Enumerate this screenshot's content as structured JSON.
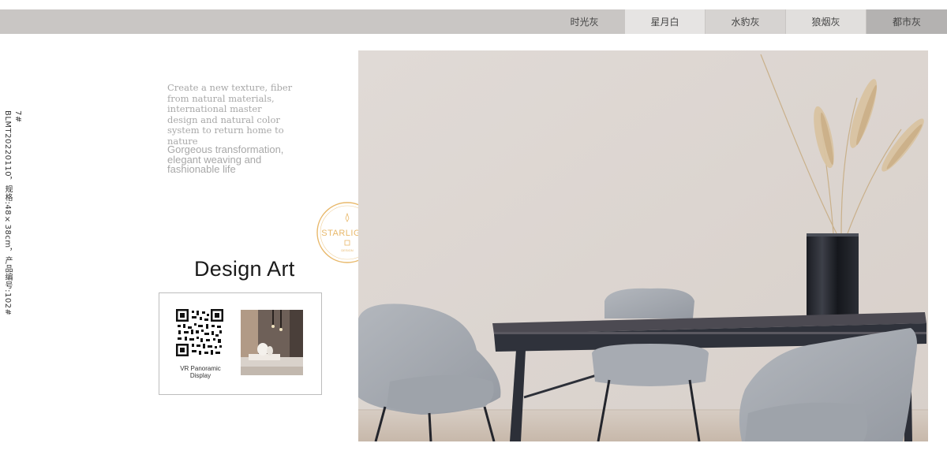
{
  "tabs": [
    "时光灰",
    "星月白",
    "水豹灰",
    "狼烟灰",
    "都市灰"
  ],
  "side_spec": {
    "page_no": "7#",
    "spec": "BLMT2022011​0，规格:48×38cm，产品编号:102#"
  },
  "intro": {
    "serif": "Create a new texture, fiber from natural materials, international master design and natural color system to return home to nature",
    "sans": "Gorgeous transformation, elegant weaving and fashionable life"
  },
  "heading": "Design Art",
  "card": {
    "qr_caption": "VR Panoramic Display"
  },
  "seal": {
    "brand": "STARLIGHT",
    "sub": "DESIGN"
  },
  "colors": {
    "topbar": "#c9c6c4",
    "tab_active": "#e6e4e3",
    "wall": "#ddd6d1",
    "chair": "#a6aab0",
    "table": "#3b3e47",
    "seal": "#e8b86a"
  }
}
